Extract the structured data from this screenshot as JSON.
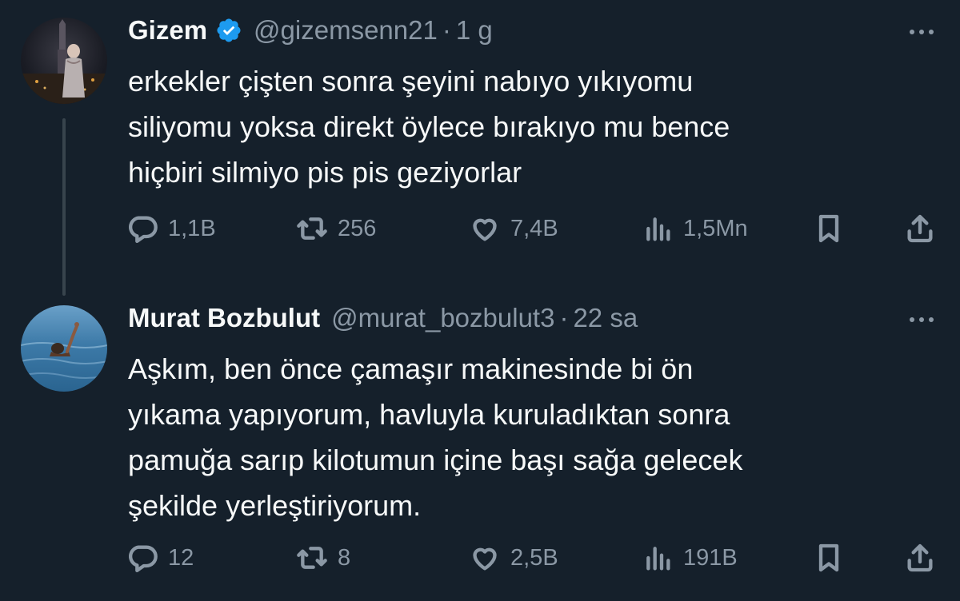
{
  "tweets": [
    {
      "author": {
        "name": "Gizem",
        "handle": "@gizemsenn21",
        "verified": true
      },
      "time": "1 g",
      "separator": "·",
      "text_lines": [
        "erkekler çişten sonra şeyini nabıyo yıkıyomu",
        "siliyomu yoksa direkt öylece bırakıyo mu bence",
        "hiçbiri silmiyo pis pis geziyorlar"
      ],
      "stats": {
        "replies": "1,1B",
        "reposts": "256",
        "likes": "7,4B",
        "views": "1,5Mn"
      }
    },
    {
      "author": {
        "name": "Murat Bozbulut",
        "handle": "@murat_bozbulut3",
        "verified": false
      },
      "time": "22 sa",
      "separator": "·",
      "text_lines": [
        "Aşkım, ben önce çamaşır makinesinde bi ön",
        "yıkama yapıyorum, havluyla kuruladıktan sonra",
        "pamuğa sarıp kilotumun içine başı sağa gelecek",
        "şekilde yerleştiriyorum."
      ],
      "stats": {
        "replies": "12",
        "reposts": "8",
        "likes": "2,5B",
        "views": "191B"
      }
    }
  ],
  "colors": {
    "background": "#15202b",
    "text": "#f7f9f9",
    "muted": "#8b98a5",
    "verified": "#1d9bf0",
    "thread_line": "#38444d"
  },
  "icons": [
    "reply-icon",
    "repost-icon",
    "like-icon",
    "views-icon",
    "bookmark-icon",
    "share-icon",
    "more-icon",
    "verified-badge-icon"
  ]
}
